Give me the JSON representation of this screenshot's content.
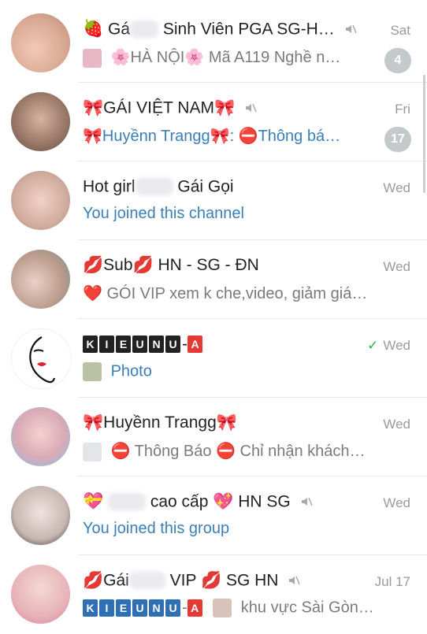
{
  "chats": [
    {
      "id": "c1",
      "title_suffix": "Sinh Viên PGA SG-H…",
      "title_prefix": "Gá",
      "time": "Sat",
      "subtitle": "🌸HÀ NỘI🌸 Mã A119 Nghề n…",
      "badge": "4",
      "muted": true
    },
    {
      "id": "c2",
      "title": "🎀GÁI VIỆT NAM🎀",
      "time": "Fri",
      "subtitle": "🎀Huyềnn Trangg🎀: ⛔Thông bá…",
      "badge": "17",
      "muted": true
    },
    {
      "id": "c3",
      "title_prefix": "Hot girl",
      "title_suffix": "Gái Gọi",
      "time": "Wed",
      "subtitle": "You joined this channel",
      "muted": false
    },
    {
      "id": "c4",
      "title": "💋Sub💋 HN - SG - ĐN",
      "time": "Wed",
      "subtitle": "❤️ GÓI VIP xem k che,video, giảm giá…",
      "muted": false
    },
    {
      "id": "c5",
      "title_letters": [
        "K",
        "I",
        "E",
        "U",
        "N",
        "U"
      ],
      "title_tail": "A",
      "time": "Wed",
      "subtitle": "Photo",
      "muted": false,
      "sent": true
    },
    {
      "id": "c6",
      "title": "🎀Huyềnn Trangg🎀",
      "time": "Wed",
      "subtitle": "⛔ Thông Báo ⛔  Chỉ nhận khách…",
      "muted": false
    },
    {
      "id": "c7",
      "title_suffix": "cao cấp 💖 HN SG",
      "time": "Wed",
      "subtitle": "You joined this group",
      "muted": true
    },
    {
      "id": "c8",
      "title_prefix": "💋Gái",
      "title_suffix": "VIP 💋 SG HN",
      "time": "Jul 17",
      "subtitle_letters": [
        "K",
        "I",
        "E",
        "U",
        "N",
        "U"
      ],
      "subtitle_tail": "A",
      "subtitle_after": "khu vực Sài Gòn…",
      "muted": true
    }
  ],
  "colors": {
    "accent_blue": "#3a7fb8",
    "badge": "#c4c9cc",
    "check_green": "#2bb34a"
  }
}
